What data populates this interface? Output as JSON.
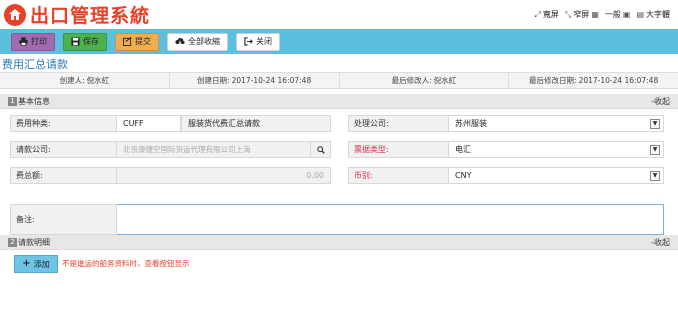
{
  "header": {
    "title": "出口管理系統",
    "views": [
      {
        "label": "寬屏",
        "icon": "expand-icon"
      },
      {
        "label": "窄屏",
        "icon": "grid-icon"
      },
      {
        "label": "一般",
        "icon": ""
      },
      {
        "label": "大字體",
        "icon": "font-size-icon"
      }
    ]
  },
  "toolbar": {
    "print": "打印",
    "save": "保存",
    "submit": "提交",
    "collapse_all": "全部收縮",
    "close": "关闭"
  },
  "page": {
    "title": "费用汇总请款"
  },
  "meta": {
    "creator_label": "创建人:",
    "creator": "倪水紅",
    "created_label": "创建日期:",
    "created": "2017-10-24 16:07:48",
    "modifier_label": "最后修改人:",
    "modifier": "倪水紅",
    "modified_label": "最后修改日期:",
    "modified": "2017-10-24 16:07:48"
  },
  "basic": {
    "num": "1",
    "title": "基本信息",
    "collapse": "-收起",
    "fee_type_label": "费用种类:",
    "fee_type_code": "CUFF",
    "fee_type_name": "服装货代费汇总请款",
    "processor_label": "处理公司:",
    "processor": "苏州服装",
    "company_label": "请款公司:",
    "company": "北京康捷空国际货运代理有限公司上海",
    "ticket_label": "票据类型:",
    "ticket": "电汇",
    "total_label": "费总额:",
    "total": "0.00",
    "currency_label": "币别:",
    "currency": "CNY",
    "notes_label": "备注:"
  },
  "detail": {
    "num": "2",
    "title": "请款明细",
    "collapse": "-收起",
    "add": "添加",
    "hint": "不是進运的船务资料时，查看按钮显示"
  }
}
